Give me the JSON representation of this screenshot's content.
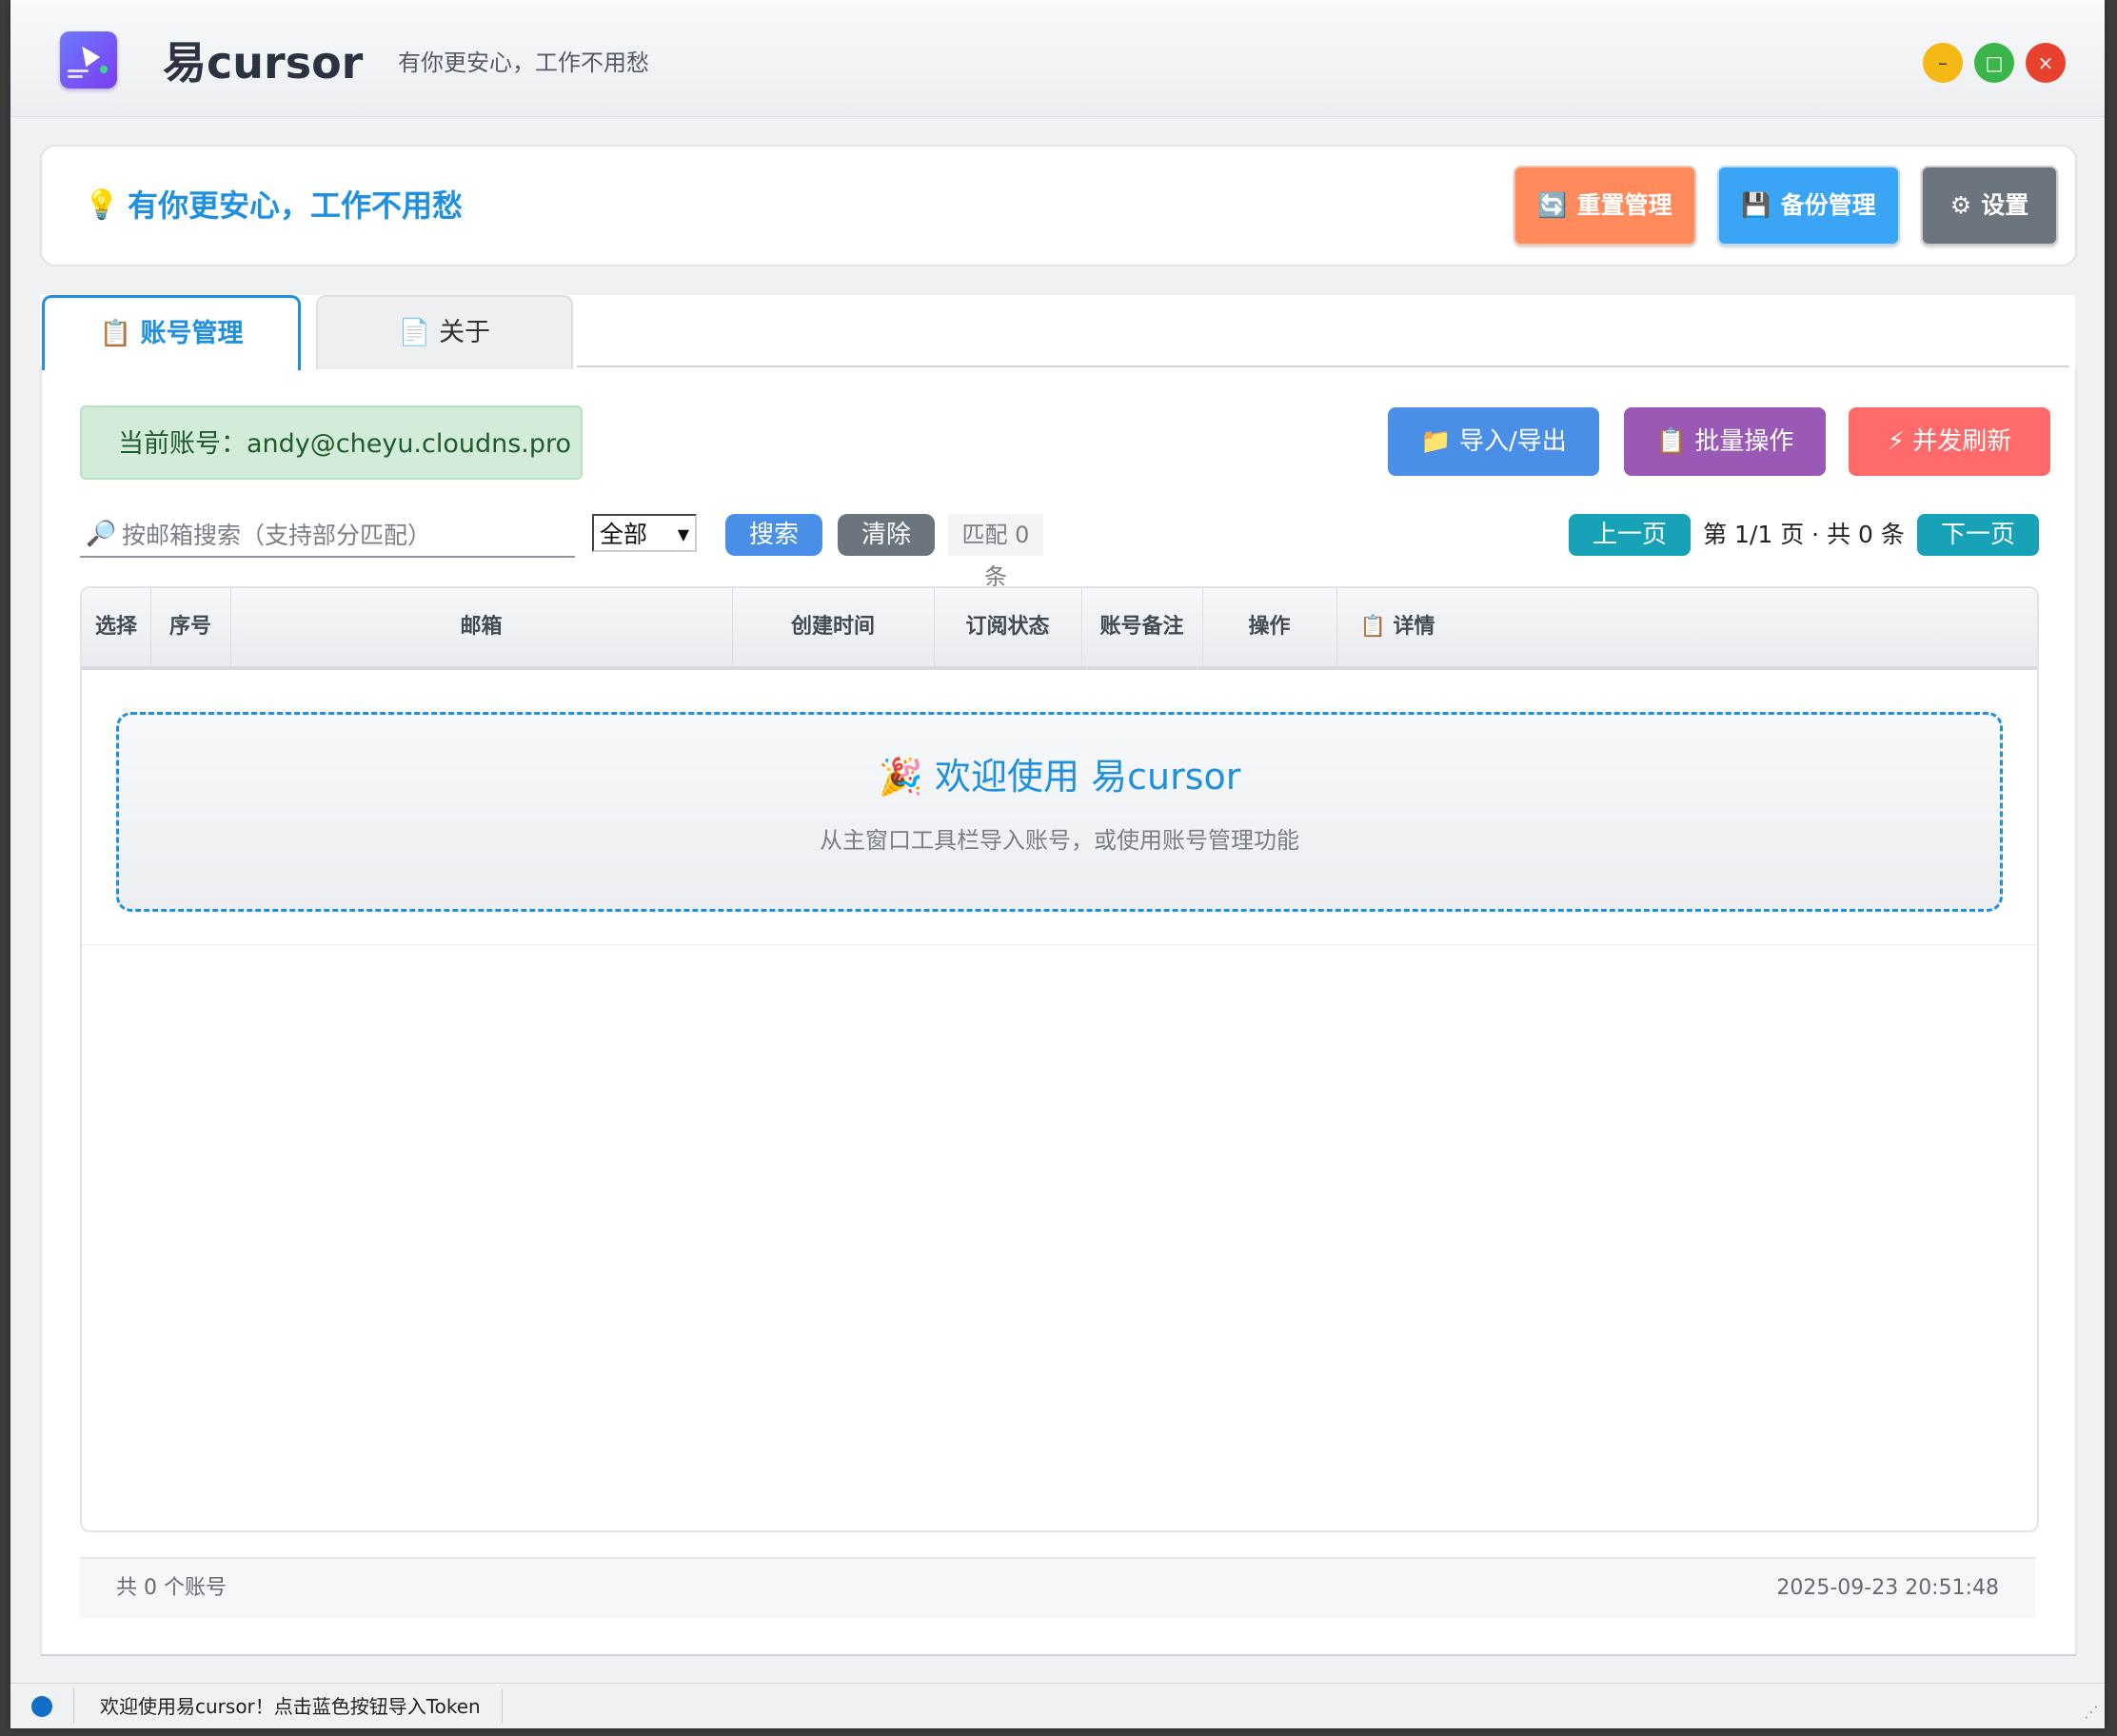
{
  "window": {
    "title": "易cursor",
    "slogan": "有你更安心，工作不用愁",
    "controls": {
      "minimize": "–",
      "maximize": "□",
      "close": "×"
    }
  },
  "header": {
    "tip_icon": "lightbulb-icon",
    "tip_text": "有你更安心，工作不用愁",
    "buttons": {
      "reset": {
        "icon": "refresh-icon",
        "label": "重置管理"
      },
      "backup": {
        "icon": "floppy-disk-icon",
        "label": "备份管理"
      },
      "settings": {
        "icon": "gear-icon",
        "label": "设置"
      }
    }
  },
  "tabs": [
    {
      "icon": "clipboard-icon",
      "label": "账号管理",
      "active": true
    },
    {
      "icon": "document-icon",
      "label": "关于",
      "active": false
    }
  ],
  "account": {
    "current_label": "当前账号：andy@cheyu.cloudns.pro"
  },
  "actions": {
    "import_export": {
      "icon": "folder-icon",
      "label": "导入/导出"
    },
    "batch": {
      "icon": "clipboard-icon",
      "label": "批量操作"
    },
    "refresh": {
      "icon": "lightning-icon",
      "label": "并发刷新"
    }
  },
  "search": {
    "placeholder": "按邮箱搜索（支持部分匹配）",
    "value": "",
    "filter_selected": "全部",
    "search_label": "搜索",
    "clear_label": "清除",
    "match_text": "匹配 0 条"
  },
  "pagination": {
    "prev_label": "上一页",
    "next_label": "下一页",
    "info": "第 1/1 页 · 共 0 条"
  },
  "table": {
    "headers": [
      "选择",
      "序号",
      "邮箱",
      "创建时间",
      "订阅状态",
      "账号备注",
      "操作",
      "详情"
    ],
    "details_icon": "clipboard-icon",
    "rows": []
  },
  "welcome": {
    "icon": "party-popper-icon",
    "title": "欢迎使用 易cursor",
    "subtitle": "从主窗口工具栏导入账号，或使用账号管理功能"
  },
  "footer": {
    "total": "共 0 个账号",
    "timestamp": "2025-09-23 20:51:48"
  },
  "statusbar": {
    "text": "欢迎使用易cursor！点击蓝色按钮导入Token"
  },
  "colors": {
    "accent": "#1f8fe0",
    "reset": "#ff8a5c",
    "backup": "#3aa4f5",
    "settings": "#6c757d",
    "import_export": "#4a8fe7",
    "batch": "#9b59b6",
    "refresh": "#ff6b6b",
    "pagination": "#17a2b8"
  }
}
